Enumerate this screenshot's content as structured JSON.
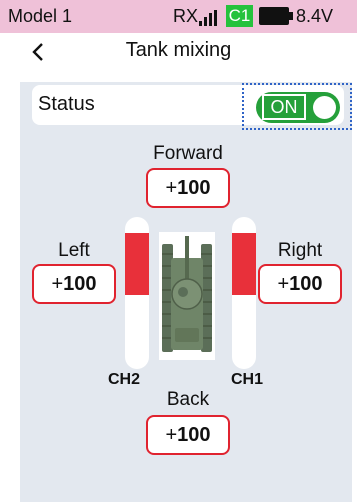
{
  "statusbar": {
    "model": "Model 1",
    "rx": "RX",
    "signal_icon": "signal-bars-icon",
    "channel_badge": "C1",
    "battery_icon": "battery-full-icon",
    "voltage": "8.4V",
    "background_color": "#efc1d8",
    "badge_color": "#25c23c"
  },
  "header": {
    "back_icon": "chevron-left-icon",
    "title": "Tank mixing"
  },
  "status": {
    "label": "Status",
    "toggle_text": "ON",
    "toggle_on": true,
    "toggle_color": "#25a03a"
  },
  "mix": {
    "forward": {
      "label": "Forward",
      "sign": "+",
      "value": "100"
    },
    "left": {
      "label": "Left",
      "sign": "+",
      "value": "100"
    },
    "right": {
      "label": "Right",
      "sign": "+",
      "value": "100"
    },
    "back": {
      "label": "Back",
      "sign": "+",
      "value": "100"
    }
  },
  "channels": {
    "ch2": {
      "label": "CH2",
      "level_percent": 50
    },
    "ch1": {
      "label": "CH1",
      "level_percent": 50
    }
  },
  "tank_icon": "tank-icon",
  "accent_color": "#e0232f"
}
